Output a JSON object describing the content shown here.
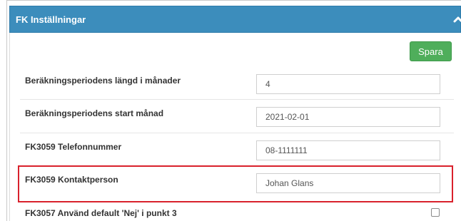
{
  "panel": {
    "title": "FK Inställningar",
    "save_label": "Spara",
    "collapse_icon": "chevron-up-icon"
  },
  "settings": [
    {
      "label": "Beräkningsperiodens längd i månader",
      "value": "4"
    },
    {
      "label": "Beräkningsperiodens start månad",
      "value": "2021-02-01"
    },
    {
      "label": "FK3059 Telefonnummer",
      "value": "08-1111111"
    },
    {
      "label": "FK3059 Kontaktperson",
      "value": "Johan Glans"
    },
    {
      "label": "FK3057 Använd default 'Nej' i punkt 3",
      "checked": false
    }
  ],
  "colors": {
    "header": "#3c8dbc",
    "save_button": "#4fae5b",
    "highlight": "#d9212c"
  }
}
